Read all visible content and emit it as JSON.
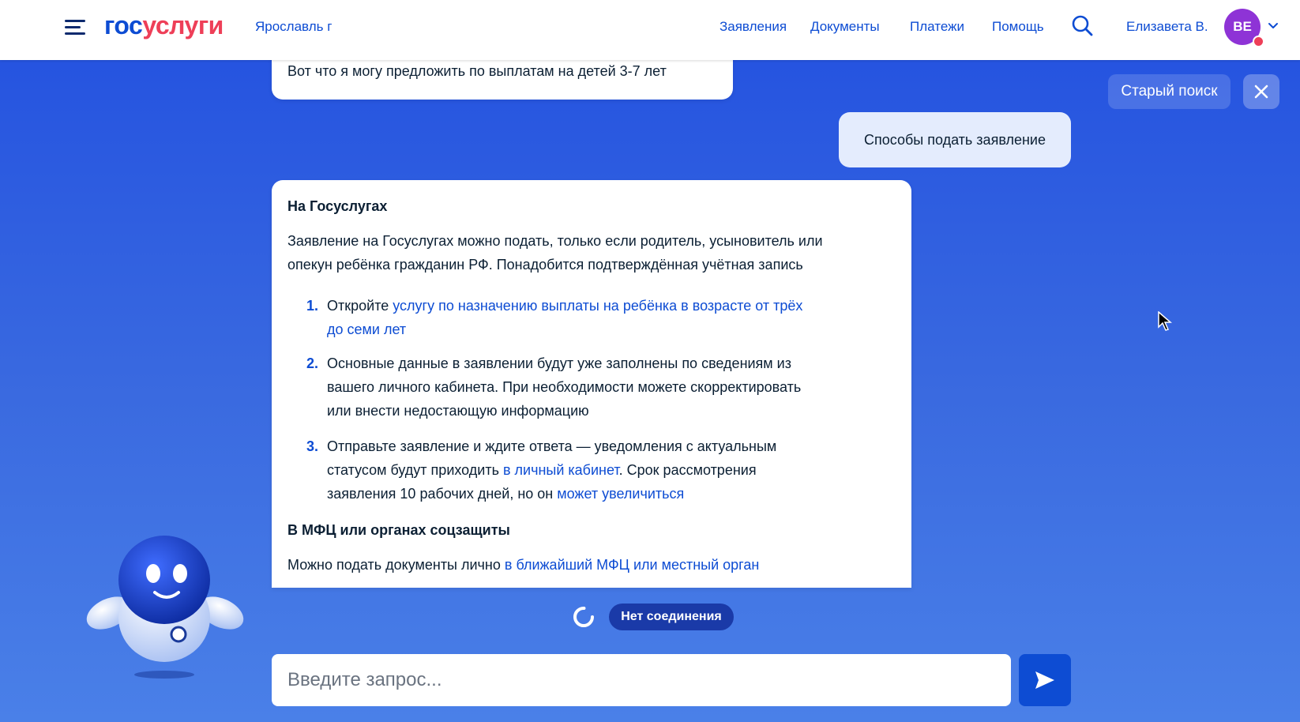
{
  "header": {
    "logo_part1": "гос",
    "logo_part2": "услуги",
    "city": "Ярославль г",
    "nav": [
      "Заявления",
      "Документы",
      "Платежи",
      "Помощь"
    ],
    "user_name": "Елизавета В.",
    "avatar_initials": "ВЕ"
  },
  "chat": {
    "prev_bot_message": "Вот что я могу предложить по выплатам на детей 3-7 лет",
    "user_message": "Способы подать заявление",
    "old_search_label": "Старый поиск",
    "answer": {
      "heading1": "На Госуслугах",
      "intro_line1": "Заявление на Госуслугах можно подать, только если родитель, усыновитель или",
      "intro_line2": "опекун ребёнка гражданин РФ. Понадобится подтверждённая учётная запись",
      "steps": [
        {
          "num": "1.",
          "line1_text": "Откройте ",
          "line1_link": "услугу по назначению выплаты на ребёнка в возрасте от трёх",
          "line2_link": "до семи лет"
        },
        {
          "num": "2.",
          "line1": "Основные данные в заявлении будут уже заполнены по сведениям из",
          "line2": "вашего личного кабинета. При необходимости можете скорректировать",
          "line3": "или внести недостающую информацию"
        },
        {
          "num": "3.",
          "line1": "Отправьте заявление и ждите ответа — уведомления с актуальным",
          "line2_text": "статусом будут приходить ",
          "line2_link": "в личный кабинет",
          "line2_tail": ". Срок рассмотрения",
          "line3_text": "заявления 10 рабочих дней, но он ",
          "line3_link": "может увеличиться"
        }
      ],
      "heading2": "В МФЦ или органах соцзащиты",
      "mfc_text": "Можно подать документы лично ",
      "mfc_link": "в ближайший МФЦ или местный орган"
    },
    "connection_status": "Нет соединения",
    "input_placeholder": "Введите запрос..."
  },
  "colors": {
    "brand_blue": "#0d4cd3",
    "brand_red": "#ee3f58",
    "avatar_purple": "#8e33d6"
  },
  "icons": [
    "menu-icon",
    "search-icon",
    "chevron-down-icon",
    "close-icon",
    "send-icon",
    "spinner-icon",
    "robot-assistant",
    "mouse-cursor"
  ]
}
